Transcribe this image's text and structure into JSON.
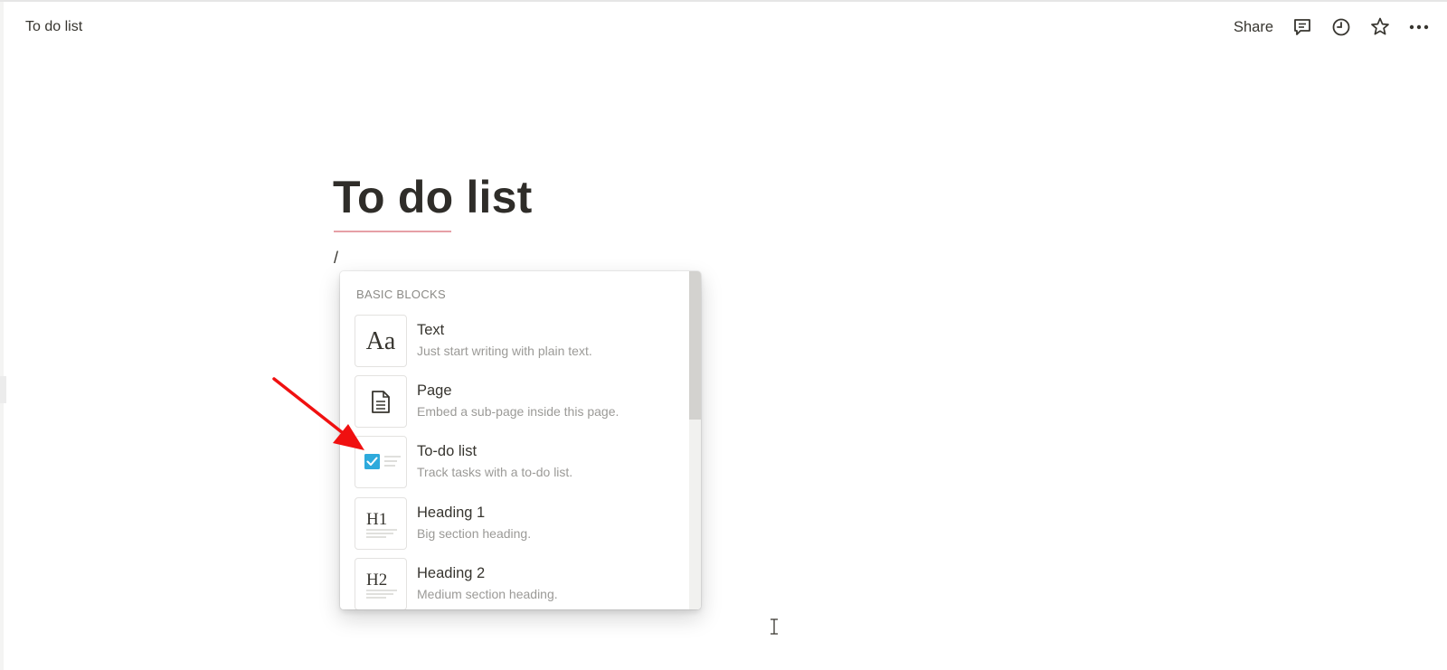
{
  "header": {
    "breadcrumb": "To do list",
    "share_label": "Share",
    "icons": [
      "comment-icon",
      "history-icon",
      "star-icon",
      "more-icon"
    ]
  },
  "page": {
    "title": "To do list",
    "input_text": "/"
  },
  "block_menu": {
    "section_label": "BASIC BLOCKS",
    "items": [
      {
        "label": "Text",
        "description": "Just start writing with plain text.",
        "icon": "text-aa-icon",
        "icon_text": "Aa"
      },
      {
        "label": "Page",
        "description": "Embed a sub-page inside this page.",
        "icon": "page-icon"
      },
      {
        "label": "To-do list",
        "description": "Track tasks with a to-do list.",
        "icon": "checkbox-icon"
      },
      {
        "label": "Heading 1",
        "description": "Big section heading.",
        "icon": "heading1-icon",
        "icon_text": "H1"
      },
      {
        "label": "Heading 2",
        "description": "Medium section heading.",
        "icon": "heading2-icon",
        "icon_text": "H2"
      }
    ]
  },
  "colors": {
    "text": "#37352f",
    "muted": "#9b9a97",
    "checkbox": "#2eaadc",
    "arrow": "#f01010",
    "spell_underline": "#e6a0a6"
  }
}
